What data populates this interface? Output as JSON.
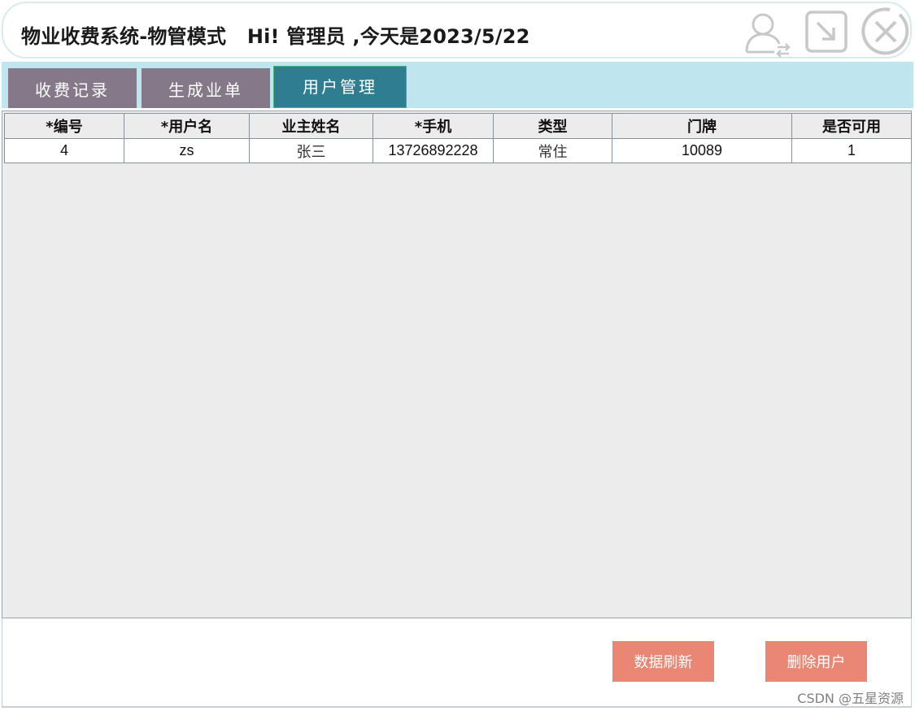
{
  "header": {
    "title": "物业收费系统-物管模式   Hi! 管理员 ,今天是2023/5/22"
  },
  "tabs": [
    {
      "label": "收费记录"
    },
    {
      "label": "生成业单"
    },
    {
      "label": "用户管理"
    }
  ],
  "table": {
    "columns": [
      "*编号",
      "*用户名",
      "业主姓名",
      "*手机",
      "类型",
      "门牌",
      "是否可用"
    ],
    "rows": [
      [
        "4",
        "zs",
        "张三",
        "13726892228",
        "常住",
        "10089",
        "1"
      ]
    ]
  },
  "buttons": {
    "refresh": "数据刷新",
    "delete": "删除用户"
  },
  "watermark": "CSDN @五星资源",
  "icons": [
    "switch-user-icon",
    "minimize-icon",
    "close-icon"
  ],
  "colors": {
    "tab_active": "#2f7d91",
    "tab_inactive": "#857888",
    "tabbar_bg": "#bfe5ee",
    "button": "#ea8674"
  }
}
